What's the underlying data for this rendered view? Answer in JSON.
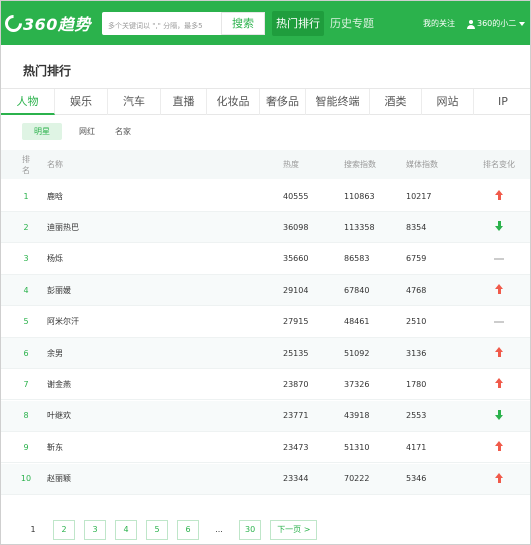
{
  "header": {
    "logo_text": "360趋势",
    "search_placeholder": "多个关键词以 \",\" 分隔，最多5",
    "search_button": "搜索",
    "nav_hot": "热门排行",
    "nav_history": "历史专题",
    "nav_follow": "我的关注",
    "nav_user": "360的小二"
  },
  "page_title": "热门排行",
  "category_tabs": [
    "人物",
    "娱乐",
    "汽车",
    "直播",
    "化妆品",
    "奢侈品",
    "智能终端",
    "酒类",
    "网站",
    "IP"
  ],
  "sub_tabs": [
    "明星",
    "网红",
    "名家"
  ],
  "table": {
    "headers": {
      "rank": "排名",
      "name": "名称",
      "heat": "热度",
      "search": "搜索指数",
      "media": "媒体指数",
      "change": "排名变化"
    },
    "rows": [
      {
        "rank": "1",
        "name": "鹿晗",
        "heat": "40555",
        "search": "110863",
        "media": "10217",
        "change": "up"
      },
      {
        "rank": "2",
        "name": "迪丽热巴",
        "heat": "36098",
        "search": "113358",
        "media": "8354",
        "change": "down"
      },
      {
        "rank": "3",
        "name": "杨烁",
        "heat": "35660",
        "search": "86583",
        "media": "6759",
        "change": "flat"
      },
      {
        "rank": "4",
        "name": "彭丽媛",
        "heat": "29104",
        "search": "67840",
        "media": "4768",
        "change": "up"
      },
      {
        "rank": "5",
        "name": "阿米尔汗",
        "heat": "27915",
        "search": "48461",
        "media": "2510",
        "change": "flat"
      },
      {
        "rank": "6",
        "name": "余男",
        "heat": "25135",
        "search": "51092",
        "media": "3136",
        "change": "up"
      },
      {
        "rank": "7",
        "name": "谢金燕",
        "heat": "23870",
        "search": "37326",
        "media": "1780",
        "change": "up"
      },
      {
        "rank": "8",
        "name": "叶继欢",
        "heat": "23771",
        "search": "43918",
        "media": "2553",
        "change": "down"
      },
      {
        "rank": "9",
        "name": "靳东",
        "heat": "23473",
        "search": "51310",
        "media": "4171",
        "change": "up"
      },
      {
        "rank": "10",
        "name": "赵丽颖",
        "heat": "23344",
        "search": "70222",
        "media": "5346",
        "change": "up"
      }
    ]
  },
  "pagination": {
    "pages": [
      "1",
      "2",
      "3",
      "4",
      "5",
      "6",
      "...",
      "30"
    ],
    "current": "1",
    "next": "下一页 >"
  },
  "colors": {
    "brand": "#2bb24c",
    "up": "#f05a4a",
    "down": "#2bb24c"
  }
}
